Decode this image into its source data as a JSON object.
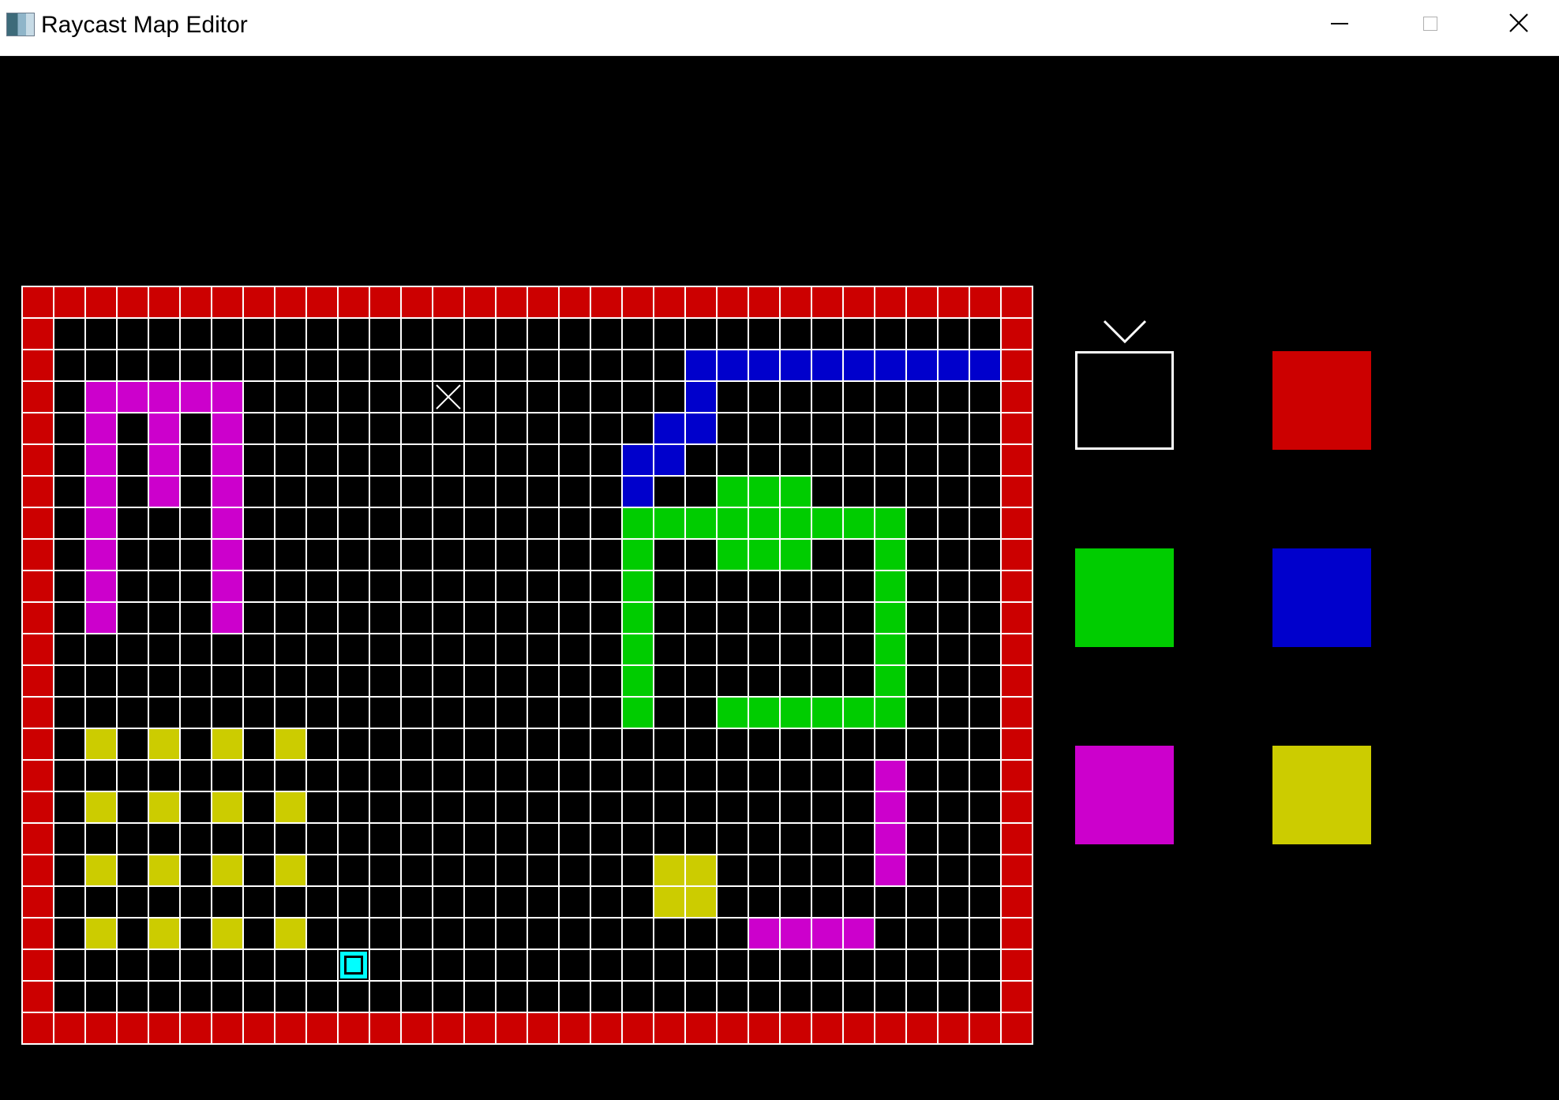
{
  "window": {
    "title": "Raycast Map Editor",
    "icon": "app-window-icon",
    "controls": [
      "minimize-icon",
      "maximize-icon",
      "close-icon"
    ]
  },
  "colors": {
    "empty": "#000000",
    "grid_line": "#ffffff",
    "red": "#cc0000",
    "green": "#00cc00",
    "blue": "#0000cc",
    "magenta": "#cc00cc",
    "yellow": "#cccc00",
    "cursor": "#00ffff"
  },
  "map": {
    "width": 32,
    "height": 24,
    "legend": {
      "0": "empty",
      "1": "red",
      "2": "green",
      "3": "blue",
      "4": "magenta",
      "5": "yellow"
    },
    "rows": [
      "11111111111111111111111111111111",
      "10000000000000000000000000000001",
      "10000000000000000000033333333331",
      "10444440000000000000030000000001",
      "10404040000000000000330000000001",
      "10404040000000000003300000000001",
      "10404040000000000003002220000001",
      "10400040000000000002222222220001",
      "10400040000000000002002220020001",
      "10400040000000000002000000020001",
      "10400040000000000002000000020001",
      "10000000000000000002000000020001",
      "10000000000000000002000000020001",
      "10000000000000000002002222220001",
      "10505050500000000000000000000001",
      "10000000000000000000000000040001",
      "10505050500000000000000000040001",
      "10000000000000000000000000040001",
      "10505050500000000000550000040001",
      "10000000000000000000550000000001",
      "10505050500000000000000444400001",
      "10000000000000000000000000000001",
      "10000000000000000000000000000001",
      "11111111111111111111111111111111"
    ],
    "player_start": {
      "col": 13,
      "row": 3,
      "icon": "player-start-x-icon"
    },
    "cursor": {
      "col": 10,
      "row": 21
    }
  },
  "palette": {
    "selected": "empty",
    "selected_indicator": "chevron-down-icon",
    "swatches": [
      {
        "id": "empty",
        "color": "#000000"
      },
      {
        "id": "red",
        "color": "#cc0000"
      },
      {
        "id": "green",
        "color": "#00cc00"
      },
      {
        "id": "blue",
        "color": "#0000cc"
      },
      {
        "id": "magenta",
        "color": "#cc00cc"
      },
      {
        "id": "yellow",
        "color": "#cccc00"
      }
    ]
  }
}
